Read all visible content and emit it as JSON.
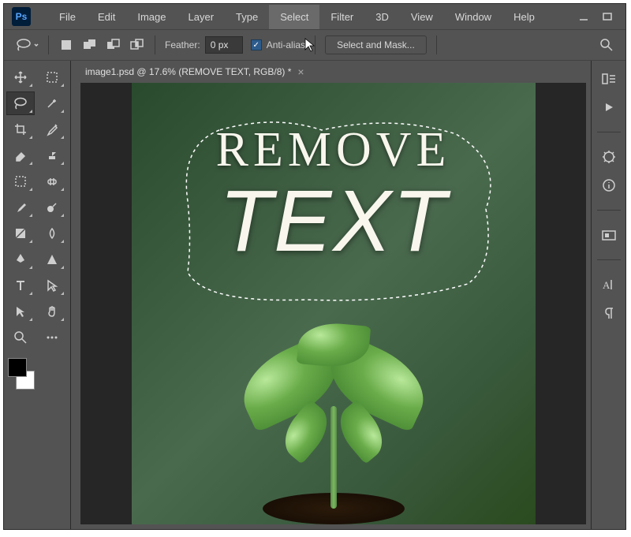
{
  "app": {
    "logo_text": "Ps"
  },
  "menu": {
    "items": [
      "File",
      "Edit",
      "Image",
      "Layer",
      "Type",
      "Select",
      "Filter",
      "3D",
      "View",
      "Window",
      "Help"
    ],
    "hovered_index": 5
  },
  "options": {
    "feather_label": "Feather:",
    "feather_value": "0 px",
    "antialias_label": "Anti-alias",
    "antialias_checked": true,
    "select_mask_label": "Select and Mask..."
  },
  "document": {
    "tab_label": "image1.psd @ 17.6% (REMOVE TEXT, RGB/8) *",
    "canvas_text_line1": "REMOVE",
    "canvas_text_line2": "TEXT"
  },
  "colors": {
    "foreground": "#000000",
    "background": "#ffffff"
  }
}
